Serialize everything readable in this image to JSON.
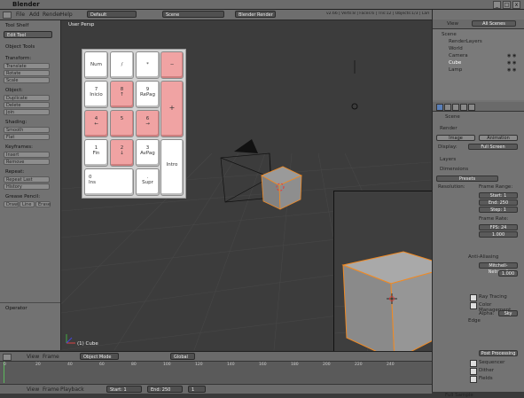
{
  "window": {
    "title": "Blender",
    "buttons": [
      "_",
      "□",
      "x"
    ]
  },
  "topbar": {
    "menus": [
      "File",
      "Add",
      "Render",
      "Help"
    ],
    "screen": "Default",
    "scene": "Scene",
    "engine": "Blender Render",
    "stats": "v2.66 | Verts:8 | Faces:6 | Tris:12 | Objects:1/3 | Lamps:0/1 | Mem:7.26M | Cube"
  },
  "toolshelf": {
    "header": "Tool Shelf",
    "mode_field": "Edit Tool",
    "section_object_tools": "Object Tools",
    "transform_heading": "Transform:",
    "transform_buttons": [
      "Translate",
      "Rotate",
      "Scale"
    ],
    "object_heading": "Object:",
    "object_buttons": [
      "Duplicate",
      "Delete",
      "Join"
    ],
    "shading_heading": "Shading:",
    "shading_buttons": [
      "Smooth",
      "Flat"
    ],
    "keyframes_heading": "Keyframes:",
    "keyframes_buttons": [
      "Insert",
      "Remove"
    ],
    "repeat_heading": "Repeat:",
    "repeat_buttons": [
      "Repeat Last",
      "History"
    ],
    "grease_heading": "Grease Pencil:",
    "grease_buttons": [
      "Draw",
      "Line",
      "Erase"
    ],
    "operator_header": "Operator"
  },
  "viewport": {
    "label": "User Persp",
    "object_label": "(1) Cube"
  },
  "numpad": {
    "keys": [
      {
        "id": "num",
        "top": "Num",
        "bottom": "",
        "red": false
      },
      {
        "id": "slash",
        "top": "/",
        "bottom": "",
        "red": false
      },
      {
        "id": "star",
        "top": "*",
        "bottom": "",
        "red": false
      },
      {
        "id": "minus",
        "top": "−",
        "bottom": "",
        "red": true
      },
      {
        "id": "k7",
        "top": "7",
        "bottom": "Inicio",
        "red": false
      },
      {
        "id": "k8",
        "top": "8",
        "bottom": "↑",
        "red": true
      },
      {
        "id": "k9",
        "top": "9",
        "bottom": "RePag",
        "red": false
      },
      {
        "id": "plus",
        "top": "+",
        "bottom": "",
        "red": true
      },
      {
        "id": "k4",
        "top": "4",
        "bottom": "←",
        "red": true
      },
      {
        "id": "k5",
        "top": "5",
        "bottom": "",
        "red": true
      },
      {
        "id": "k6",
        "top": "6",
        "bottom": "→",
        "red": true
      },
      {
        "id": "k1",
        "top": "1",
        "bottom": "Fin",
        "red": false
      },
      {
        "id": "k2",
        "top": "2",
        "bottom": "↓",
        "red": true
      },
      {
        "id": "k3",
        "top": "3",
        "bottom": "AvPag",
        "red": false
      },
      {
        "id": "intro",
        "top": "Intro",
        "bottom": "",
        "red": false
      },
      {
        "id": "k0",
        "top": "0",
        "bottom": "Ins",
        "red": false
      },
      {
        "id": "dot",
        "top": ".",
        "bottom": "Supr",
        "red": false
      }
    ]
  },
  "timeline": {
    "menus": [
      "View",
      "Frame",
      "Playback"
    ],
    "mode": "Object Mode",
    "pivot": "Global",
    "ruler": [
      "0",
      "20",
      "40",
      "60",
      "80",
      "100",
      "120",
      "140",
      "160",
      "180",
      "200",
      "220",
      "240"
    ],
    "start_label": "Start: 1",
    "end_label": "End: 250",
    "current": "1"
  },
  "outliner": {
    "view": "View",
    "search": "All Scenes",
    "items": [
      "Scene",
      "RenderLayers",
      "World",
      "Camera",
      "Cube",
      "Lamp"
    ]
  },
  "properties": {
    "context_label": "Scene",
    "render_header": "Render",
    "render_buttons": [
      "Image",
      "Animation"
    ],
    "display_label": "Display:",
    "display_value": "Full Screen",
    "layers_header": "Layers",
    "dimensions_header": "Dimensions",
    "presets": "Presets",
    "resolution_label": "Resolution:",
    "frame_range_label": "Frame Range:",
    "start_frame": "Start: 1",
    "end_frame": "End: 250",
    "step": "Step: 1",
    "frame_rate_label": "Frame Rate:",
    "fps": "FPS: 24",
    "time_stretch": "1.000",
    "anti_aliasing_header": "Anti-Aliasing",
    "ray_tracing": "Ray Tracing",
    "color_management": "Color Management",
    "alpha_label": "Alpha:",
    "alpha_value": "Sky",
    "edge_label": "Edge",
    "sequencer": "Sequencer",
    "dither": "Dither",
    "fields": "Fields",
    "full_sample": "Full Sample",
    "post_processing_header": "Post Processing",
    "color_codes": {
      "selected_outline": "#f08a24",
      "key_highlight": "#f0a3a3"
    }
  }
}
